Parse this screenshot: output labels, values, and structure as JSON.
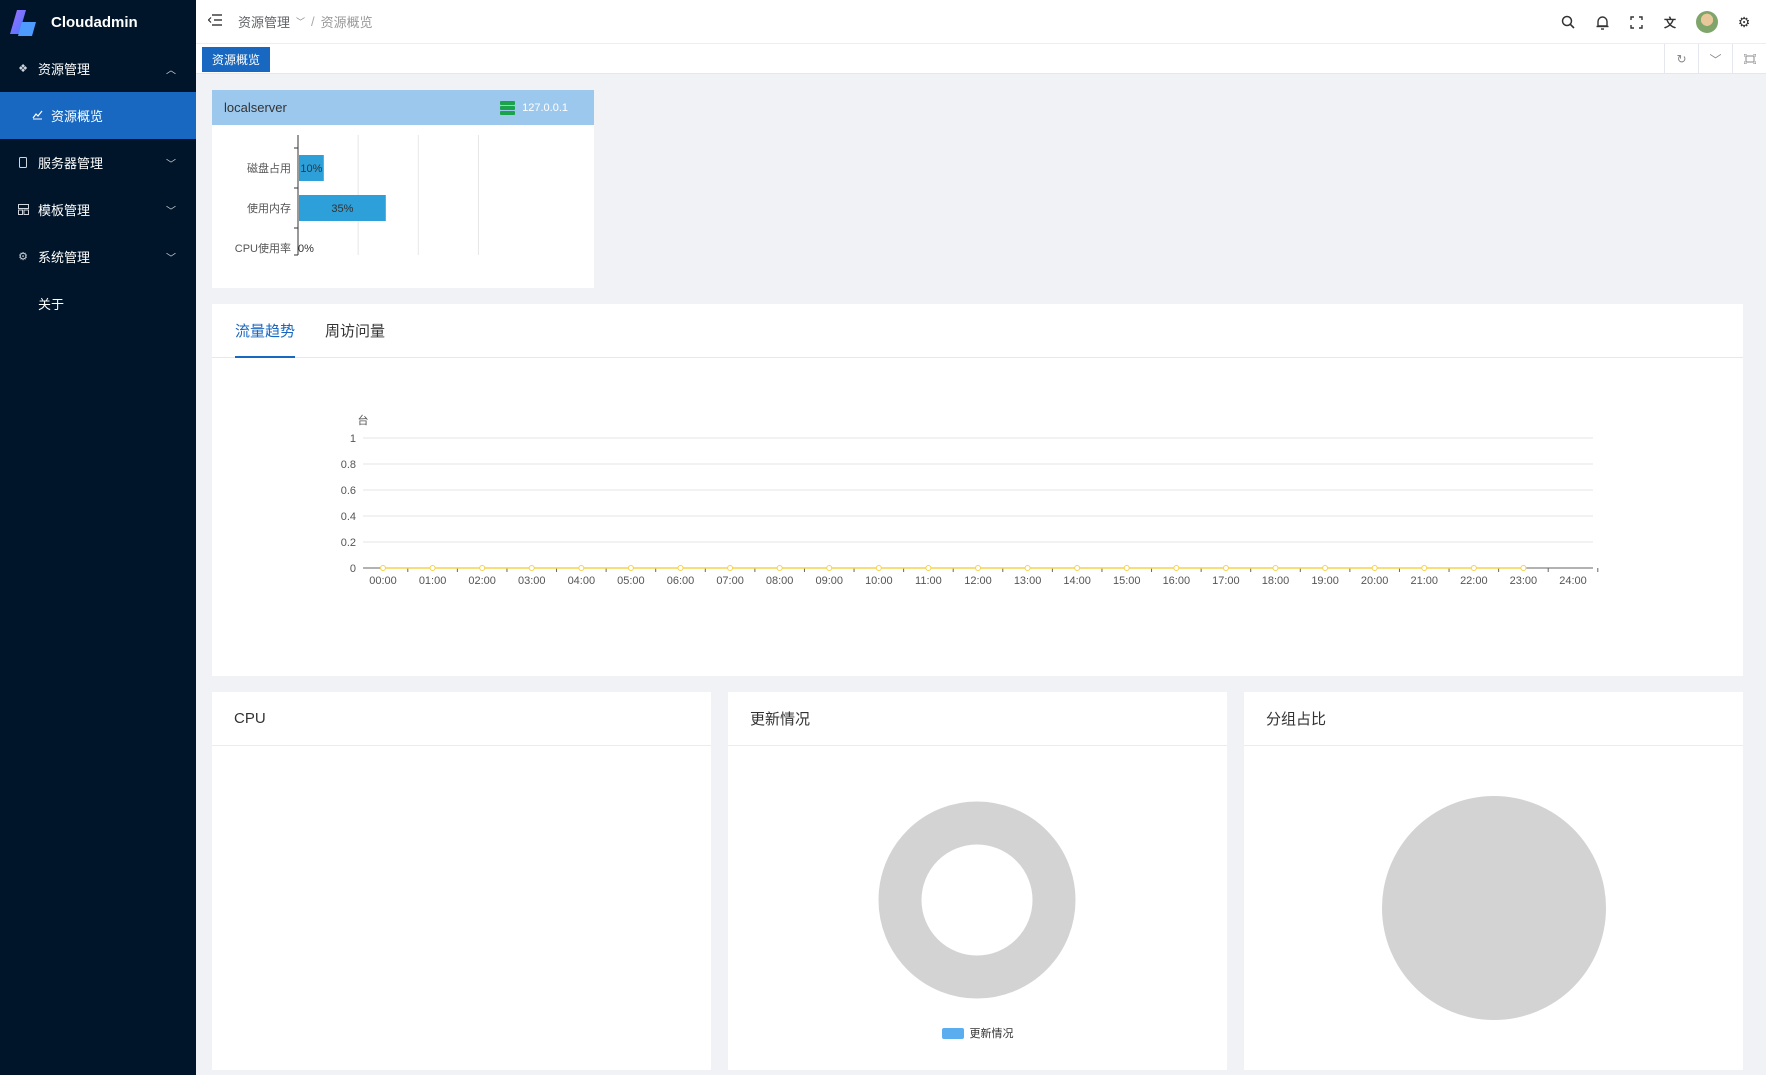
{
  "app": {
    "title": "Cloudadmin"
  },
  "sidebar": {
    "items": [
      {
        "label": "资源管理",
        "icon": "diamond-icon",
        "expanded": true
      },
      {
        "label": "资源概览",
        "icon": "chart-icon",
        "active": true
      },
      {
        "label": "服务器管理",
        "icon": "phone-icon"
      },
      {
        "label": "模板管理",
        "icon": "layout-icon"
      },
      {
        "label": "系统管理",
        "icon": "gear-icon"
      },
      {
        "label": "关于",
        "icon": "info-icon"
      }
    ]
  },
  "header": {
    "breadcrumb": [
      "资源管理",
      "资源概览"
    ]
  },
  "tabs": {
    "active": "资源概览"
  },
  "server": {
    "name": "localserver",
    "ip": "127.0.0.1"
  },
  "tab_panels": {
    "traffic": "流量趋势",
    "visits": "周访问量"
  },
  "panels": {
    "cpu": "CPU",
    "update": "更新情况",
    "group": "分组占比"
  },
  "legend": {
    "update": "更新情况"
  },
  "colors": {
    "sidebar": "#001529",
    "accent": "#1867c0",
    "bar": "#2d9fd9",
    "line": "#f5d24c",
    "pie": "#d3d3d3"
  },
  "chart_data": [
    {
      "type": "bar",
      "orientation": "horizontal",
      "categories": [
        "磁盘占用",
        "使用内存",
        "CPU使用率"
      ],
      "values": [
        10,
        35,
        0
      ],
      "labels": [
        "10%",
        "35%",
        "0%"
      ]
    },
    {
      "type": "line",
      "ylabel": "台",
      "x": [
        "00:00",
        "01:00",
        "02:00",
        "03:00",
        "04:00",
        "05:00",
        "06:00",
        "07:00",
        "08:00",
        "09:00",
        "10:00",
        "11:00",
        "12:00",
        "13:00",
        "14:00",
        "15:00",
        "16:00",
        "17:00",
        "18:00",
        "19:00",
        "20:00",
        "21:00",
        "22:00",
        "23:00",
        "24:00"
      ],
      "series": [
        {
          "values": [
            0,
            0,
            0,
            0,
            0,
            0,
            0,
            0,
            0,
            0,
            0,
            0,
            0,
            0,
            0,
            0,
            0,
            0,
            0,
            0,
            0,
            0,
            0,
            0
          ]
        }
      ],
      "ylim": [
        0,
        1
      ],
      "yticks": [
        "0",
        "0.2",
        "0.4",
        "0.6",
        "0.8",
        "1"
      ],
      "grid": true
    },
    {
      "type": "pie",
      "variant": "donut",
      "legend": [
        "更新情况"
      ],
      "values": []
    },
    {
      "type": "pie",
      "values": []
    }
  ]
}
